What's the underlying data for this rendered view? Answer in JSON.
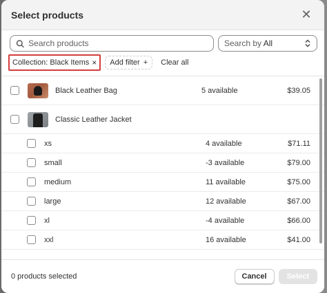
{
  "modal": {
    "title": "Select products",
    "close_icon": "close-icon"
  },
  "search": {
    "placeholder": "Search products",
    "value": "",
    "icon": "search-icon",
    "search_by_prefix": "Search by",
    "search_by_value": "All",
    "select_icon": "chevron-up-down-icon"
  },
  "filters": {
    "chip_label": "Collection: Black Items",
    "chip_remove": "×",
    "add_filter_label": "Add filter",
    "add_filter_icon": "+",
    "clear_all_label": "Clear all",
    "highlight_color": "#d43d3d"
  },
  "products": [
    {
      "name": "Black Leather Bag",
      "availability": "5 available",
      "price": "$39.05",
      "thumb": "bag"
    },
    {
      "name": "Classic Leather Jacket",
      "availability": "",
      "price": "",
      "thumb": "jacket",
      "variants": [
        {
          "name": "xs",
          "availability": "4 available",
          "price": "$71.11"
        },
        {
          "name": "small",
          "availability": "-3 available",
          "price": "$79.00"
        },
        {
          "name": "medium",
          "availability": "11 available",
          "price": "$75.00"
        },
        {
          "name": "large",
          "availability": "12 available",
          "price": "$67.00"
        },
        {
          "name": "xl",
          "availability": "-4 available",
          "price": "$66.00"
        },
        {
          "name": "xxl",
          "availability": "16 available",
          "price": "$41.00"
        }
      ]
    }
  ],
  "footer": {
    "selected_count": "0 products selected",
    "cancel_label": "Cancel",
    "select_label": "Select"
  }
}
